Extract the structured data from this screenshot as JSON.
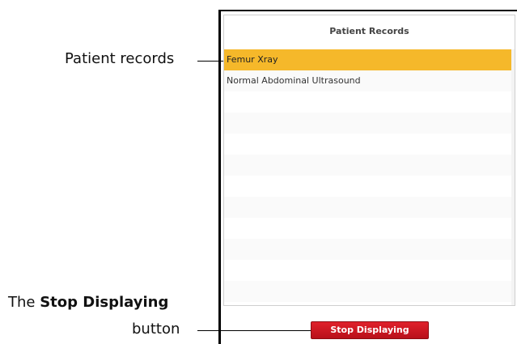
{
  "callouts": {
    "records_label": "Patient records",
    "stop_label_prefix": "The ",
    "stop_label_bold": "Stop Displaying",
    "stop_label_suffix": "button"
  },
  "panel": {
    "title": "Patient Records",
    "rows": [
      {
        "label": "Femur Xray",
        "selected": true
      },
      {
        "label": "Normal Abdominal Ultrasound",
        "selected": false
      },
      {
        "label": "",
        "selected": false
      },
      {
        "label": "",
        "selected": false
      },
      {
        "label": "",
        "selected": false
      },
      {
        "label": "",
        "selected": false
      },
      {
        "label": "",
        "selected": false
      },
      {
        "label": "",
        "selected": false
      },
      {
        "label": "",
        "selected": false
      },
      {
        "label": "",
        "selected": false
      },
      {
        "label": "",
        "selected": false
      },
      {
        "label": "",
        "selected": false
      }
    ],
    "selected_color": "#f5b82a"
  },
  "stop_button": {
    "label": "Stop Displaying",
    "color": "#d4141f"
  }
}
